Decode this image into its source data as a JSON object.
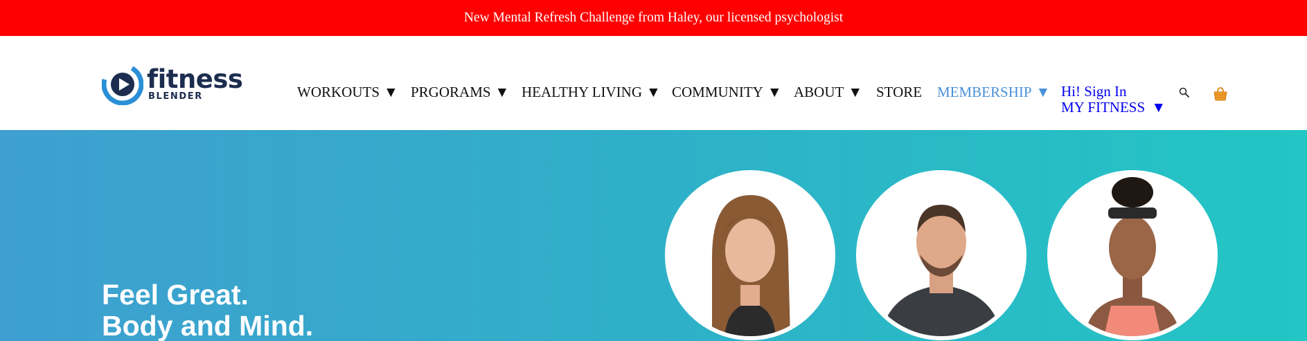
{
  "promo": {
    "text": "New Mental Refresh Challenge from Haley, our licensed psychologist",
    "bg_color": "#ff0000"
  },
  "logo": {
    "word_main": "fitness",
    "word_sub": "BLENDER",
    "icon": "play-logo-icon"
  },
  "nav": {
    "items": [
      {
        "label": "WORKOUTS",
        "caret": "▼"
      },
      {
        "label": "PRGORAMS",
        "caret": "▼"
      },
      {
        "label": "HEALTHY LIVING",
        "caret": "▼"
      },
      {
        "label": "COMMUNITY",
        "caret": "▼"
      },
      {
        "label": "ABOUT",
        "caret": "▼"
      },
      {
        "label": "STORE",
        "caret": ""
      },
      {
        "label": "MEMBERSHIP",
        "caret": "▼"
      }
    ],
    "signin": {
      "greeting": "Hi! Sign In",
      "my_fitness": "MY FITNESS",
      "caret": "▼"
    },
    "search_icon": "search-icon",
    "cart_icon": "cart-icon",
    "accent_color": "#4a90d9",
    "link_color": "#0000ee"
  },
  "hero": {
    "title_line1": "Feel Great.",
    "title_line2": "Body and Mind.",
    "gradient": [
      "#3f9fd0",
      "#22c6c4"
    ],
    "trainers": [
      "trainer-photo-woman",
      "trainer-photo-man",
      "trainer-photo-woman-headband"
    ]
  }
}
